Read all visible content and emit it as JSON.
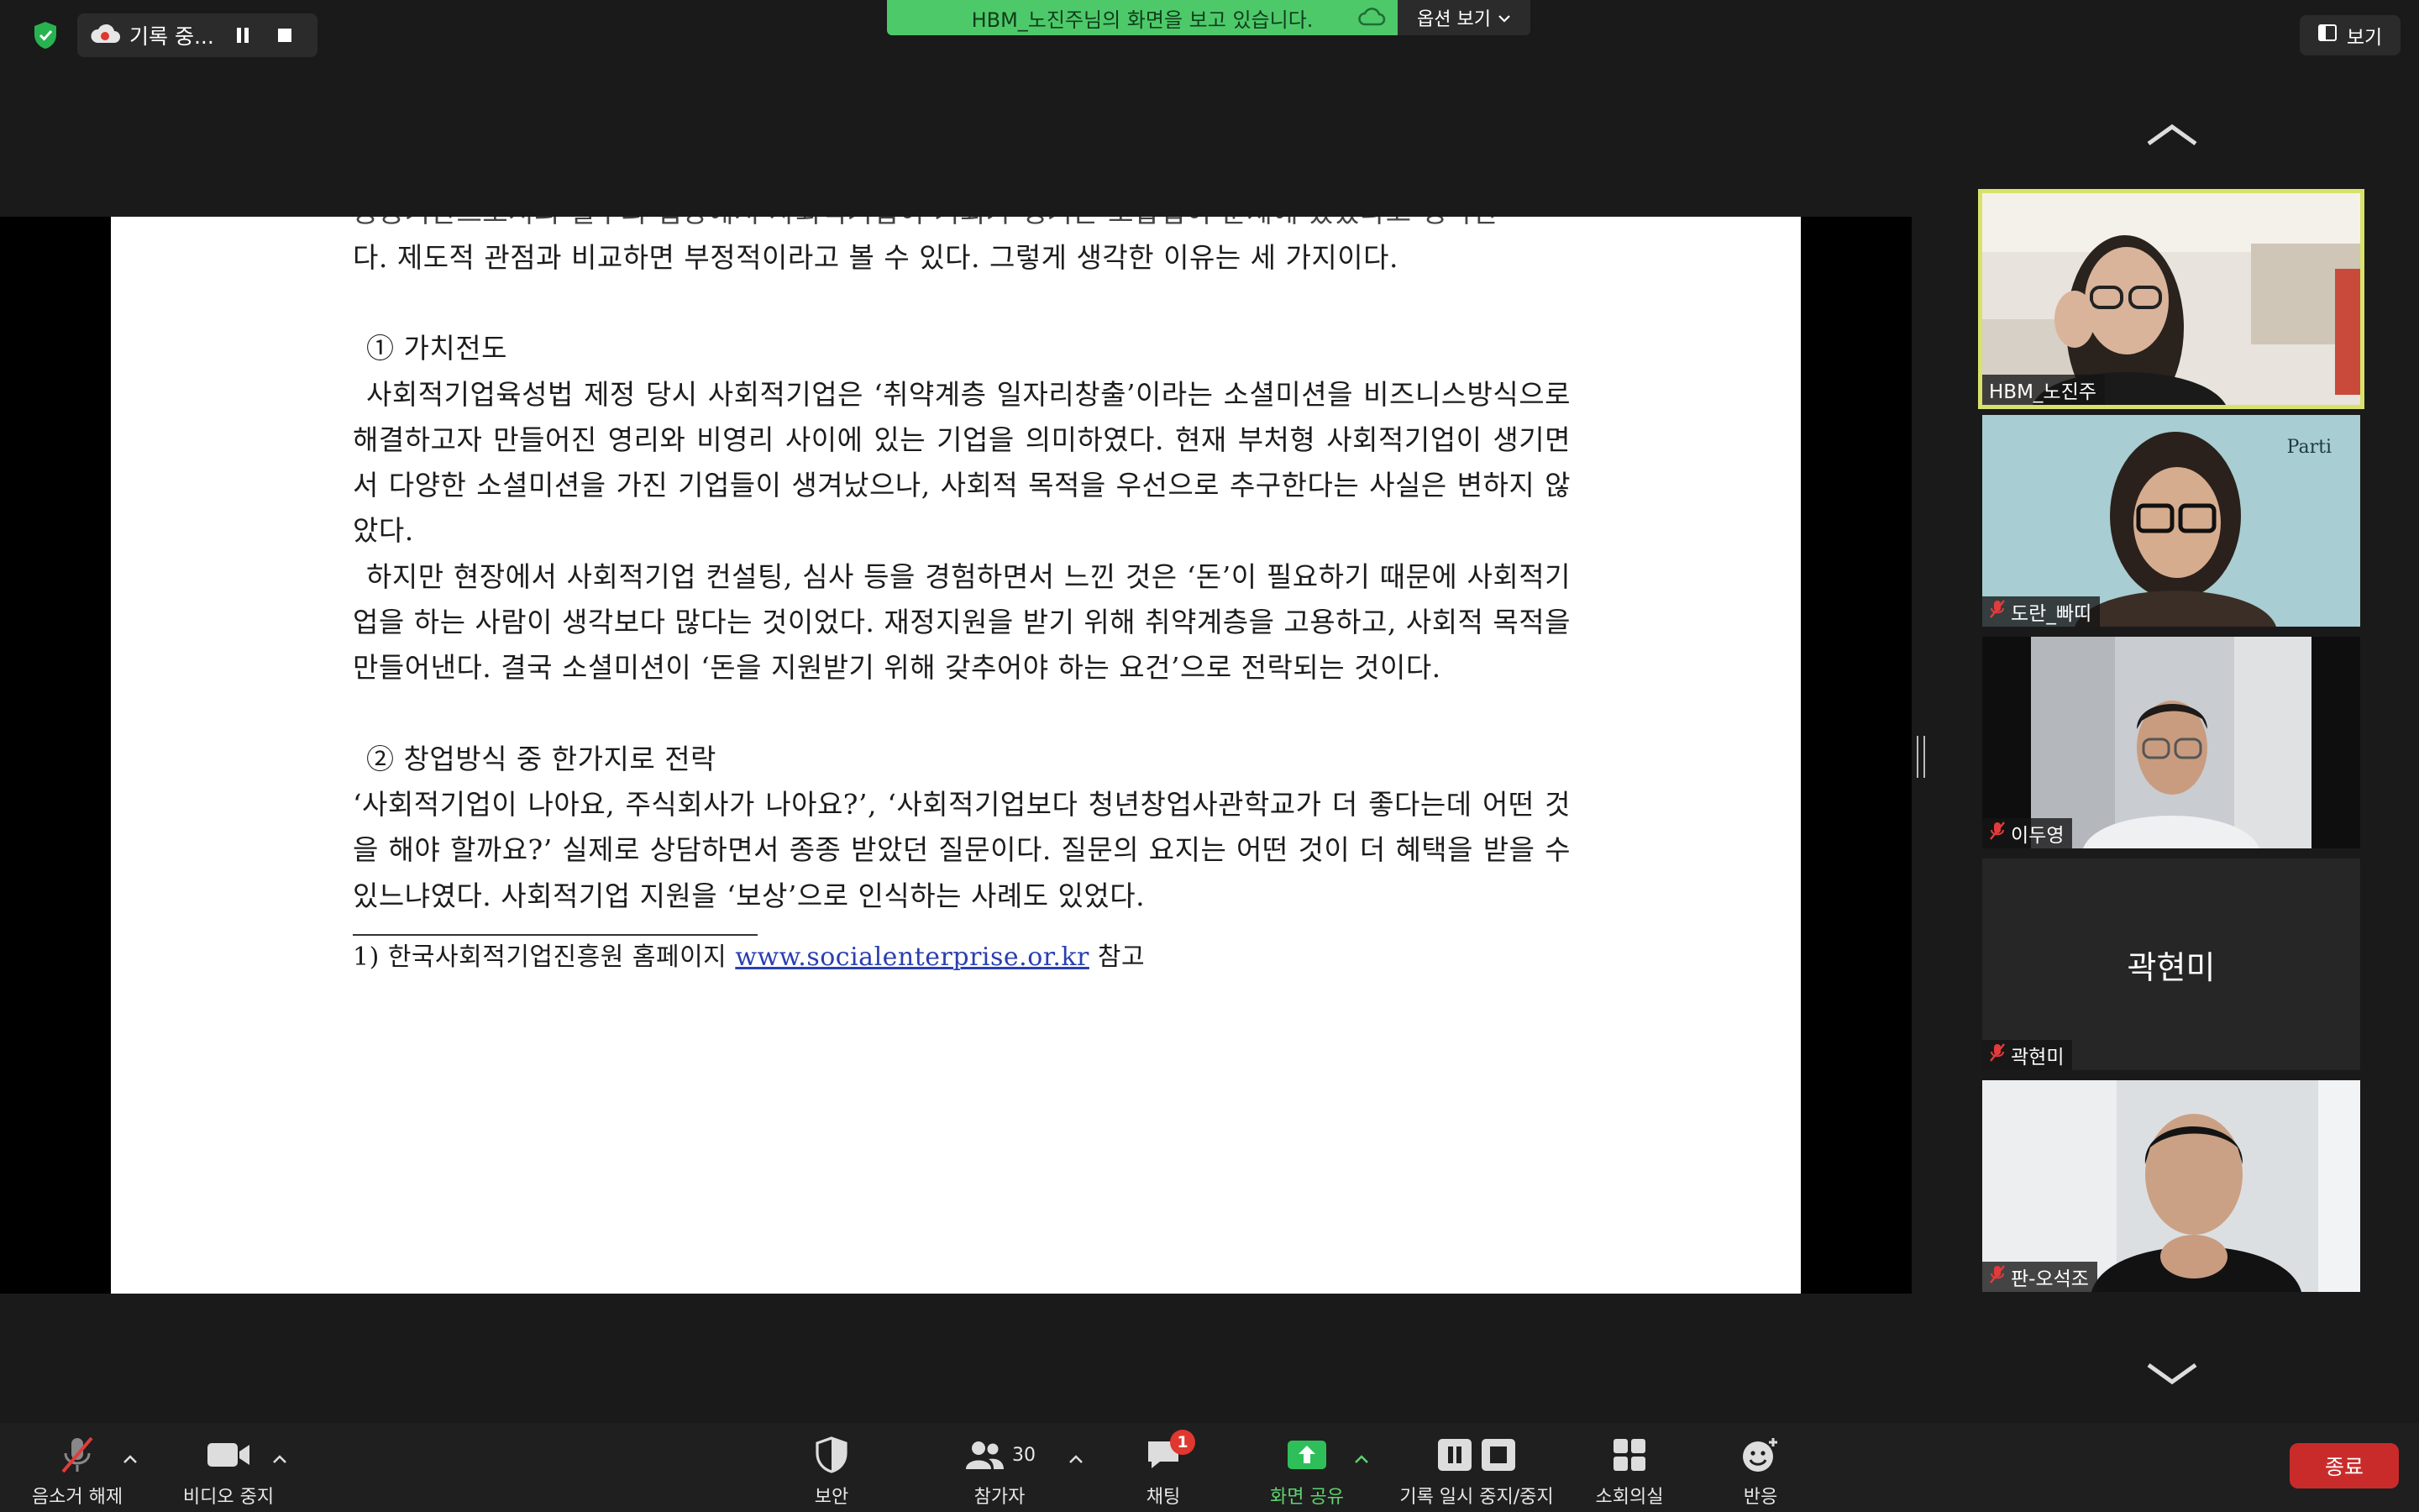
{
  "top_bar": {
    "recording_label": "기록 중...",
    "share_banner": "HBM_노진주님의 화면을 보고 있습니다.",
    "view_options_label": "옵션 보기",
    "view_label": "보기"
  },
  "document": {
    "cut_line": "공공기관으로서의 일부의 입장에서 사회적기업이 기회가 생기는 조합법이 문제에 있었다고 생각한",
    "lines": [
      "다. 제도적 관점과 비교하면 부정적이라고 볼 수 있다. 그렇게 생각한 이유는 세 가지이다.",
      "",
      "① 가치전도",
      "사회적기업육성법 제정 당시 사회적기업은 ‘취약계층 일자리창출’이라는 소셜미션을 비즈니스방식으로 해결하고자 만들어진 영리와 비영리 사이에 있는 기업을 의미하였다. 현재 부처형 사회적기업이 생기면서 다양한 소셜미션을 가진 기업들이 생겨났으나, 사회적 목적을 우선으로 추구한다는 사실은 변하지 않았다.",
      "하지만 현장에서 사회적기업 컨설팅, 심사 등을 경험하면서 느낀 것은 ‘돈’이 필요하기 때문에 사회적기업을 하는 사람이 생각보다 많다는 것이었다. 재정지원을 받기 위해 취약계층을 고용하고, 사회적 목적을 만들어낸다. 결국 소셜미션이 ‘돈을 지원받기 위해 갖추어야 하는 요건’으로 전락되는 것이다.",
      "",
      "② 창업방식 중 한가지로 전락",
      "‘사회적기업이 나아요, 주식회사가 나아요?’, ‘사회적기업보다 청년창업사관학교가 더 좋다는데 어떤 것을 해야 할까요?’ 실제로 상담하면서 종종 받았던 질문이다. 질문의 요지는 어떤 것이 더 혜택을 받을 수 있느냐였다. 사회적기업 지원을 ‘보상’으로 인식하는 사례도 있었다."
    ],
    "footnote_prefix": "1) 한국사회적기업진흥원 홈페이지 ",
    "footnote_link": "www.socialenterprise.or.kr",
    "footnote_suffix": " 참고"
  },
  "participants": [
    {
      "name": "HBM_노진주",
      "muted": false,
      "video": true,
      "active": true
    },
    {
      "name": "도란_빠띠",
      "muted": true,
      "video": true,
      "active": false,
      "wall_text": "Parti"
    },
    {
      "name": "이두영",
      "muted": true,
      "video": true,
      "active": false
    },
    {
      "name": "곽현미",
      "muted": true,
      "video": false,
      "active": false,
      "display_name": "곽현미"
    },
    {
      "name": "판-오석조",
      "muted": true,
      "video": true,
      "active": false
    }
  ],
  "toolbar": {
    "unmute": "음소거 해제",
    "stop_video": "비디오 중지",
    "security": "보안",
    "participants": "참가자",
    "participants_count": "30",
    "chat": "채팅",
    "chat_badge": "1",
    "share_screen": "화면 공유",
    "pause_stop_recording": "기록 일시 중지/중지",
    "breakout_rooms": "소회의실",
    "reactions": "반응",
    "end": "종료"
  },
  "colors": {
    "share_banner_bg": "#4ec96a",
    "active_speaker_outline": "#d8e26a",
    "end_button": "#c92b2b",
    "chat_badge": "#e0372f",
    "share_active": "#5fd36f"
  }
}
